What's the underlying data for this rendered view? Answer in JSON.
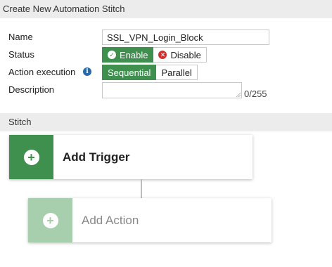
{
  "header": {
    "title": "Create New Automation Stitch"
  },
  "form": {
    "name_label": "Name",
    "name_value": "SSL_VPN_Login_Block",
    "status_label": "Status",
    "status_options": [
      "Enable",
      "Disable"
    ],
    "status_selected": "Enable",
    "action_execution_label": "Action execution",
    "action_execution_options": [
      "Sequential",
      "Parallel"
    ],
    "action_execution_selected": "Sequential",
    "description_label": "Description",
    "description_value": "",
    "description_counter": "0/255"
  },
  "stitch": {
    "section_title": "Stitch",
    "trigger_label": "Add Trigger",
    "action_label": "Add Action"
  },
  "colors": {
    "accent_green": "#3f8f4f",
    "light_green": "#a8cfad",
    "disable_red": "#d0312d",
    "info_blue": "#2a6aa8"
  },
  "icons": {
    "enable": "check-circle-icon",
    "disable": "x-circle-icon",
    "info": "info-icon",
    "add": "plus-circle-icon"
  }
}
